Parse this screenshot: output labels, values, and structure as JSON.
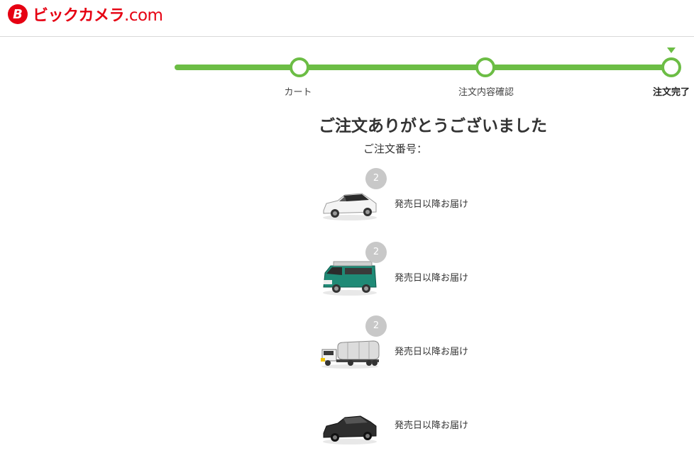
{
  "header": {
    "logo_text": "ビックカメラ",
    "logo_suffix": ".com",
    "logo_mark_letter": "B",
    "brand_color": "#e60012"
  },
  "steps": {
    "accent_color": "#6cbd45",
    "items": [
      {
        "label": "カート"
      },
      {
        "label": "注文内容確認"
      },
      {
        "label": "注文完了",
        "current": true
      }
    ]
  },
  "main": {
    "title": "ご注文ありがとうございました",
    "order_number_label": "ご注文番号："
  },
  "items": [
    {
      "qty": "2",
      "status": "発売日以降お届け",
      "image": "white-car-icon"
    },
    {
      "qty": "2",
      "status": "発売日以降お届け",
      "image": "green-van-icon"
    },
    {
      "qty": "2",
      "status": "発売日以降お届け",
      "image": "tanker-truck-icon"
    },
    {
      "qty": "",
      "status": "発売日以降お届け",
      "image": "black-car-icon"
    }
  ]
}
